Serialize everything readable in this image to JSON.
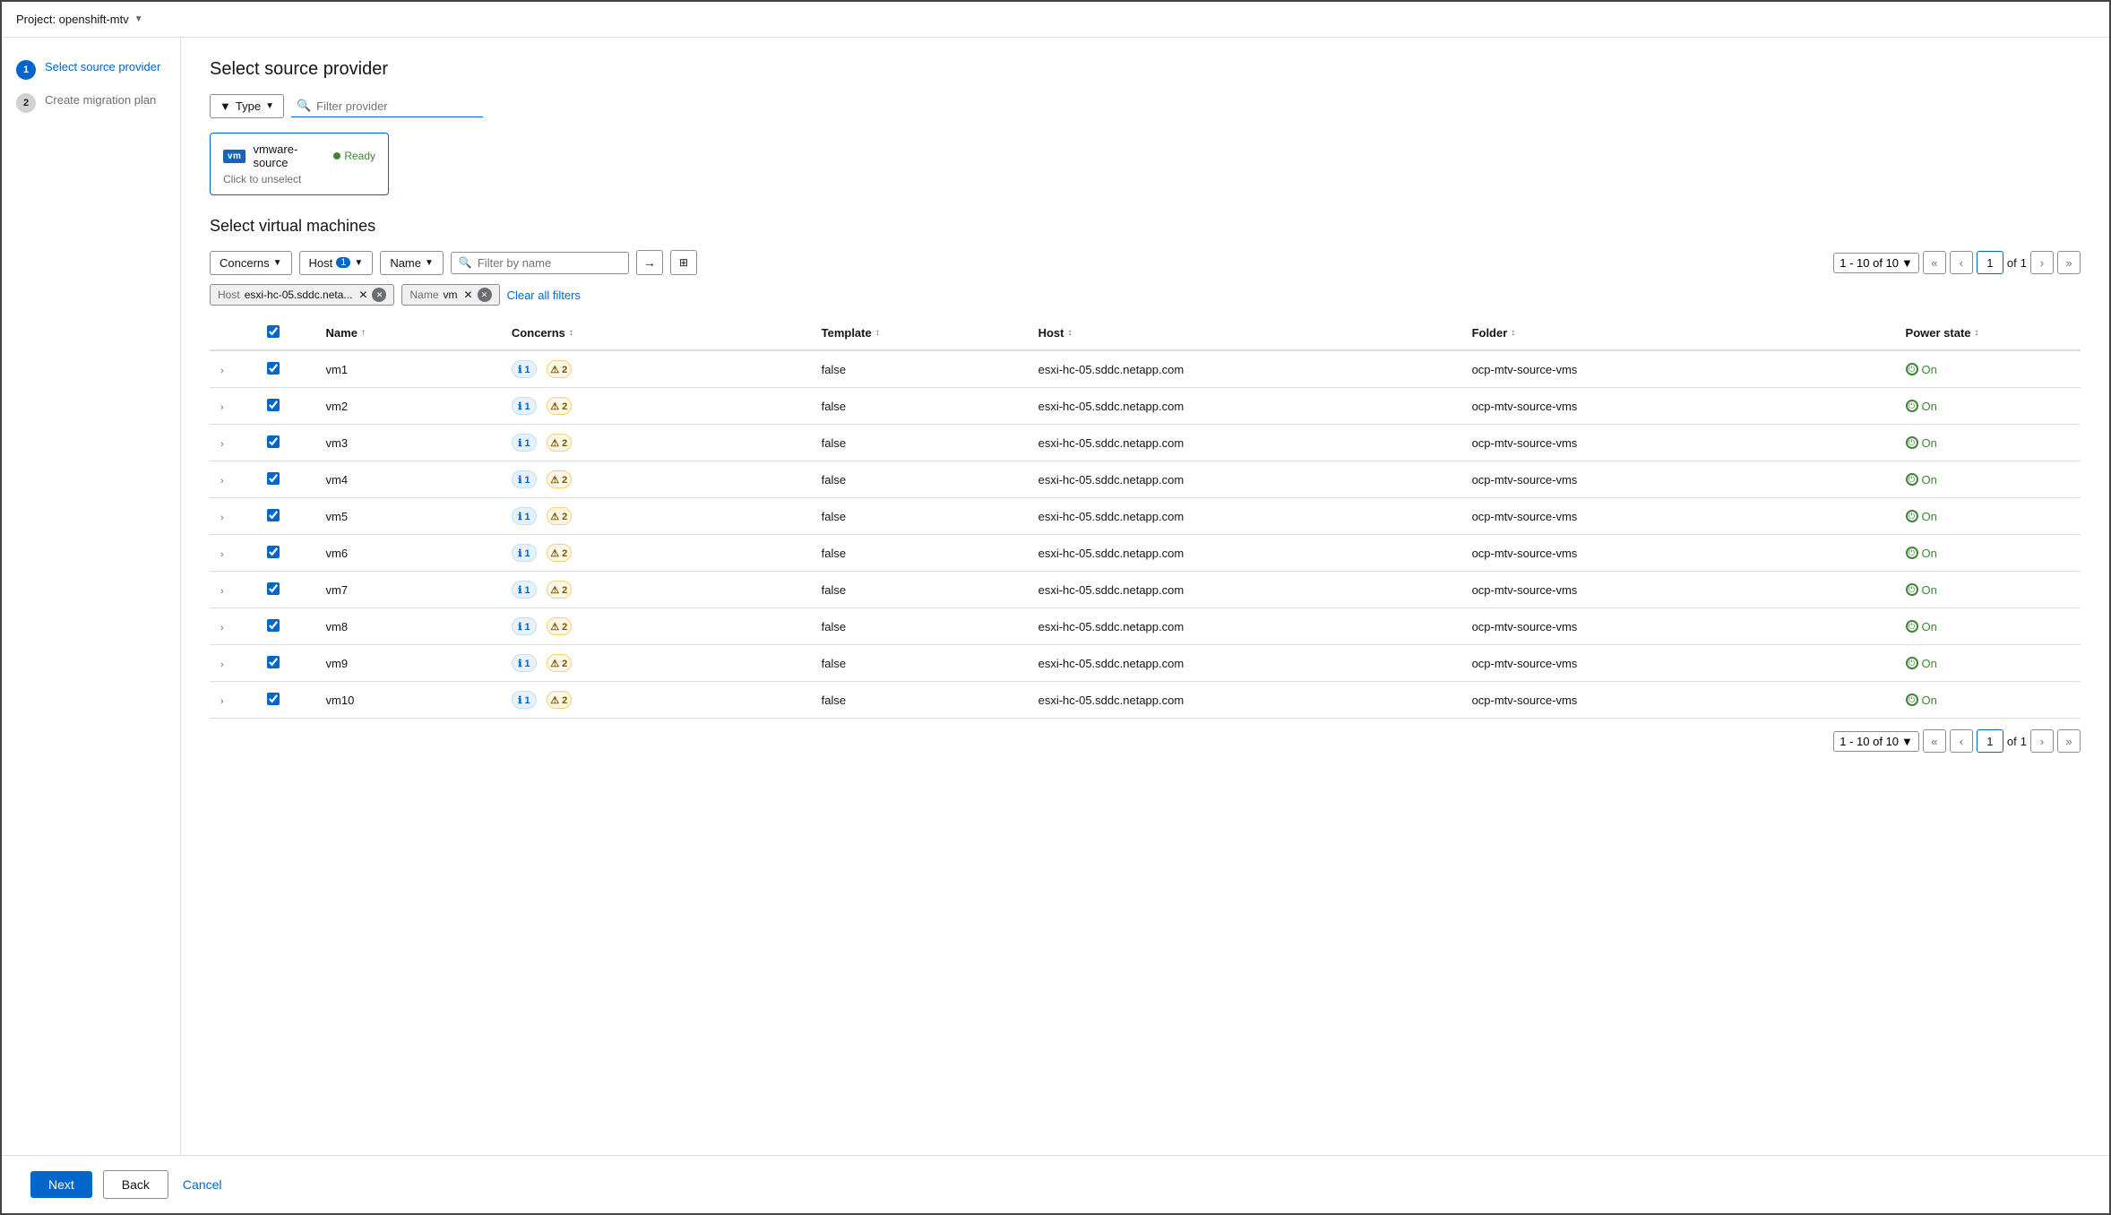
{
  "topBar": {
    "project": "Project: openshift-mtv",
    "chevron": "▼"
  },
  "sidebar": {
    "steps": [
      {
        "number": "1",
        "label": "Select source provider",
        "state": "active"
      },
      {
        "number": "2",
        "label": "Create migration plan",
        "state": "inactive"
      }
    ]
  },
  "sourceProvider": {
    "sectionTitle": "Select source provider",
    "filterTypeLabel": "Type",
    "filterPlaceholder": "Filter provider",
    "card": {
      "logoText": "vm",
      "name": "vmware-source",
      "readyLabel": "Ready",
      "clickToUnselect": "Click to unselect"
    }
  },
  "vmSection": {
    "sectionTitle": "Select virtual machines",
    "toolbar": {
      "concernsLabel": "Concerns",
      "hostLabel": "Host",
      "hostValue": "1",
      "nameLabel": "Name",
      "filterPlaceholder": "Filter by name"
    },
    "pagination": {
      "range": "1 - 10 of 10",
      "chevron": "▼",
      "currentPage": "1",
      "totalPages": "1",
      "ofLabel": "of"
    },
    "activeFilters": [
      {
        "label": "Host",
        "value": "esxi-hc-05.sddc.neta...",
        "hasX": true,
        "hasClear": true
      },
      {
        "label": "Name",
        "value": "vm",
        "hasX": true,
        "hasClear": true
      }
    ],
    "clearAll": "Clear all filters",
    "table": {
      "columns": [
        {
          "key": "name",
          "label": "Name",
          "sortable": true,
          "sortDir": "asc"
        },
        {
          "key": "concerns",
          "label": "Concerns",
          "sortable": true
        },
        {
          "key": "template",
          "label": "Template",
          "sortable": true
        },
        {
          "key": "host",
          "label": "Host",
          "sortable": true
        },
        {
          "key": "folder",
          "label": "Folder",
          "sortable": true
        },
        {
          "key": "powerState",
          "label": "Power state",
          "sortable": true
        }
      ],
      "rows": [
        {
          "id": "vm1",
          "name": "vm1",
          "infoCount": "1",
          "warnCount": "2",
          "template": "false",
          "host": "esxi-hc-05.sddc.netapp.com",
          "folder": "ocp-mtv-source-vms",
          "powerState": "On",
          "checked": true
        },
        {
          "id": "vm2",
          "name": "vm2",
          "infoCount": "1",
          "warnCount": "2",
          "template": "false",
          "host": "esxi-hc-05.sddc.netapp.com",
          "folder": "ocp-mtv-source-vms",
          "powerState": "On",
          "checked": true
        },
        {
          "id": "vm3",
          "name": "vm3",
          "infoCount": "1",
          "warnCount": "2",
          "template": "false",
          "host": "esxi-hc-05.sddc.netapp.com",
          "folder": "ocp-mtv-source-vms",
          "powerState": "On",
          "checked": true
        },
        {
          "id": "vm4",
          "name": "vm4",
          "infoCount": "1",
          "warnCount": "2",
          "template": "false",
          "host": "esxi-hc-05.sddc.netapp.com",
          "folder": "ocp-mtv-source-vms",
          "powerState": "On",
          "checked": true
        },
        {
          "id": "vm5",
          "name": "vm5",
          "infoCount": "1",
          "warnCount": "2",
          "template": "false",
          "host": "esxi-hc-05.sddc.netapp.com",
          "folder": "ocp-mtv-source-vms",
          "powerState": "On",
          "checked": true
        },
        {
          "id": "vm6",
          "name": "vm6",
          "infoCount": "1",
          "warnCount": "2",
          "template": "false",
          "host": "esxi-hc-05.sddc.netapp.com",
          "folder": "ocp-mtv-source-vms",
          "powerState": "On",
          "checked": true
        },
        {
          "id": "vm7",
          "name": "vm7",
          "infoCount": "1",
          "warnCount": "2",
          "template": "false",
          "host": "esxi-hc-05.sddc.netapp.com",
          "folder": "ocp-mtv-source-vms",
          "powerState": "On",
          "checked": true
        },
        {
          "id": "vm8",
          "name": "vm8",
          "infoCount": "1",
          "warnCount": "2",
          "template": "false",
          "host": "esxi-hc-05.sddc.netapp.com",
          "folder": "ocp-mtv-source-vms",
          "powerState": "On",
          "checked": true
        },
        {
          "id": "vm9",
          "name": "vm9",
          "infoCount": "1",
          "warnCount": "2",
          "template": "false",
          "host": "esxi-hc-05.sddc.netapp.com",
          "folder": "ocp-mtv-source-vms",
          "powerState": "On",
          "checked": true
        },
        {
          "id": "vm10",
          "name": "vm10",
          "infoCount": "1",
          "warnCount": "2",
          "template": "false",
          "host": "esxi-hc-05.sddc.netapp.com",
          "folder": "ocp-mtv-source-vms",
          "powerState": "On",
          "checked": true
        }
      ]
    }
  },
  "bottomBar": {
    "nextLabel": "Next",
    "backLabel": "Back",
    "cancelLabel": "Cancel"
  }
}
